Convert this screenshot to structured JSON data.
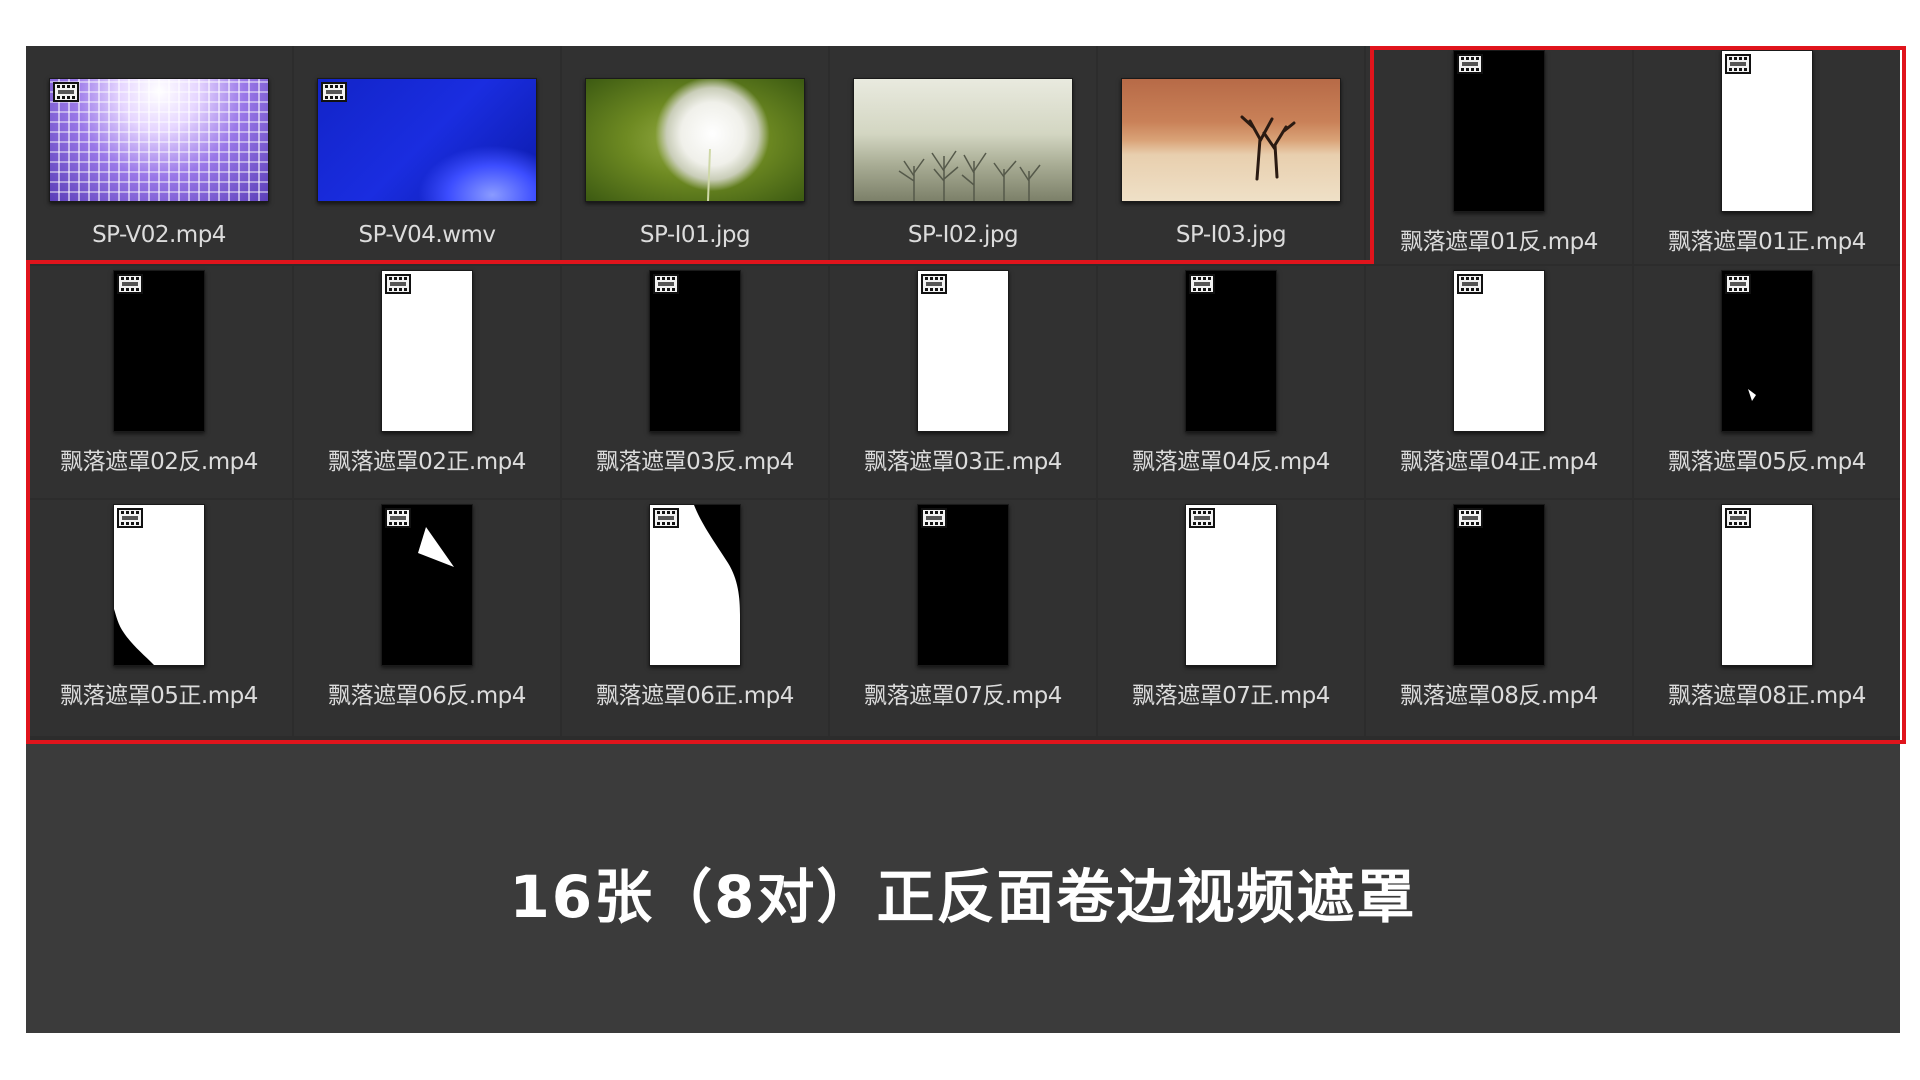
{
  "caption": "16张（8对）正反面卷边视频遮罩",
  "colors": {
    "highlight_frame": "#e0141c",
    "panel_bg": "#3b3b3b",
    "cell_bg": "#313131"
  },
  "row1": [
    {
      "label": "SP-V02.mp4",
      "kind": "video",
      "thumb": "purple-light-grid"
    },
    {
      "label": "SP-V04.wmv",
      "kind": "video",
      "thumb": "blue-abstract"
    },
    {
      "label": "SP-I01.jpg",
      "kind": "image",
      "thumb": "dandelion"
    },
    {
      "label": "SP-I02.jpg",
      "kind": "image",
      "thumb": "misty-trees"
    },
    {
      "label": "SP-I03.jpg",
      "kind": "image",
      "thumb": "desert-tree"
    },
    {
      "label": "飘落遮罩01反.mp4",
      "kind": "video",
      "thumb": "black-mask"
    },
    {
      "label": "飘落遮罩01正.mp4",
      "kind": "video",
      "thumb": "white-mask"
    }
  ],
  "row2": [
    {
      "label": "飘落遮罩02反.mp4",
      "kind": "video",
      "thumb": "black-mask"
    },
    {
      "label": "飘落遮罩02正.mp4",
      "kind": "video",
      "thumb": "white-mask"
    },
    {
      "label": "飘落遮罩03反.mp4",
      "kind": "video",
      "thumb": "black-mask"
    },
    {
      "label": "飘落遮罩03正.mp4",
      "kind": "video",
      "thumb": "white-mask"
    },
    {
      "label": "飘落遮罩04反.mp4",
      "kind": "video",
      "thumb": "black-mask"
    },
    {
      "label": "飘落遮罩04正.mp4",
      "kind": "video",
      "thumb": "white-mask"
    },
    {
      "label": "飘落遮罩05反.mp4",
      "kind": "video",
      "thumb": "black-mask-small-curl"
    }
  ],
  "row3": [
    {
      "label": "飘落遮罩05正.mp4",
      "kind": "video",
      "thumb": "white-mask-curl"
    },
    {
      "label": "飘落遮罩06反.mp4",
      "kind": "video",
      "thumb": "black-mask-fold"
    },
    {
      "label": "飘落遮罩06正.mp4",
      "kind": "video",
      "thumb": "white-mask-fold"
    },
    {
      "label": "飘落遮罩07反.mp4",
      "kind": "video",
      "thumb": "black-mask"
    },
    {
      "label": "飘落遮罩07正.mp4",
      "kind": "video",
      "thumb": "white-mask"
    },
    {
      "label": "飘落遮罩08反.mp4",
      "kind": "video",
      "thumb": "black-mask"
    },
    {
      "label": "飘落遮罩08正.mp4",
      "kind": "video",
      "thumb": "white-mask"
    }
  ]
}
